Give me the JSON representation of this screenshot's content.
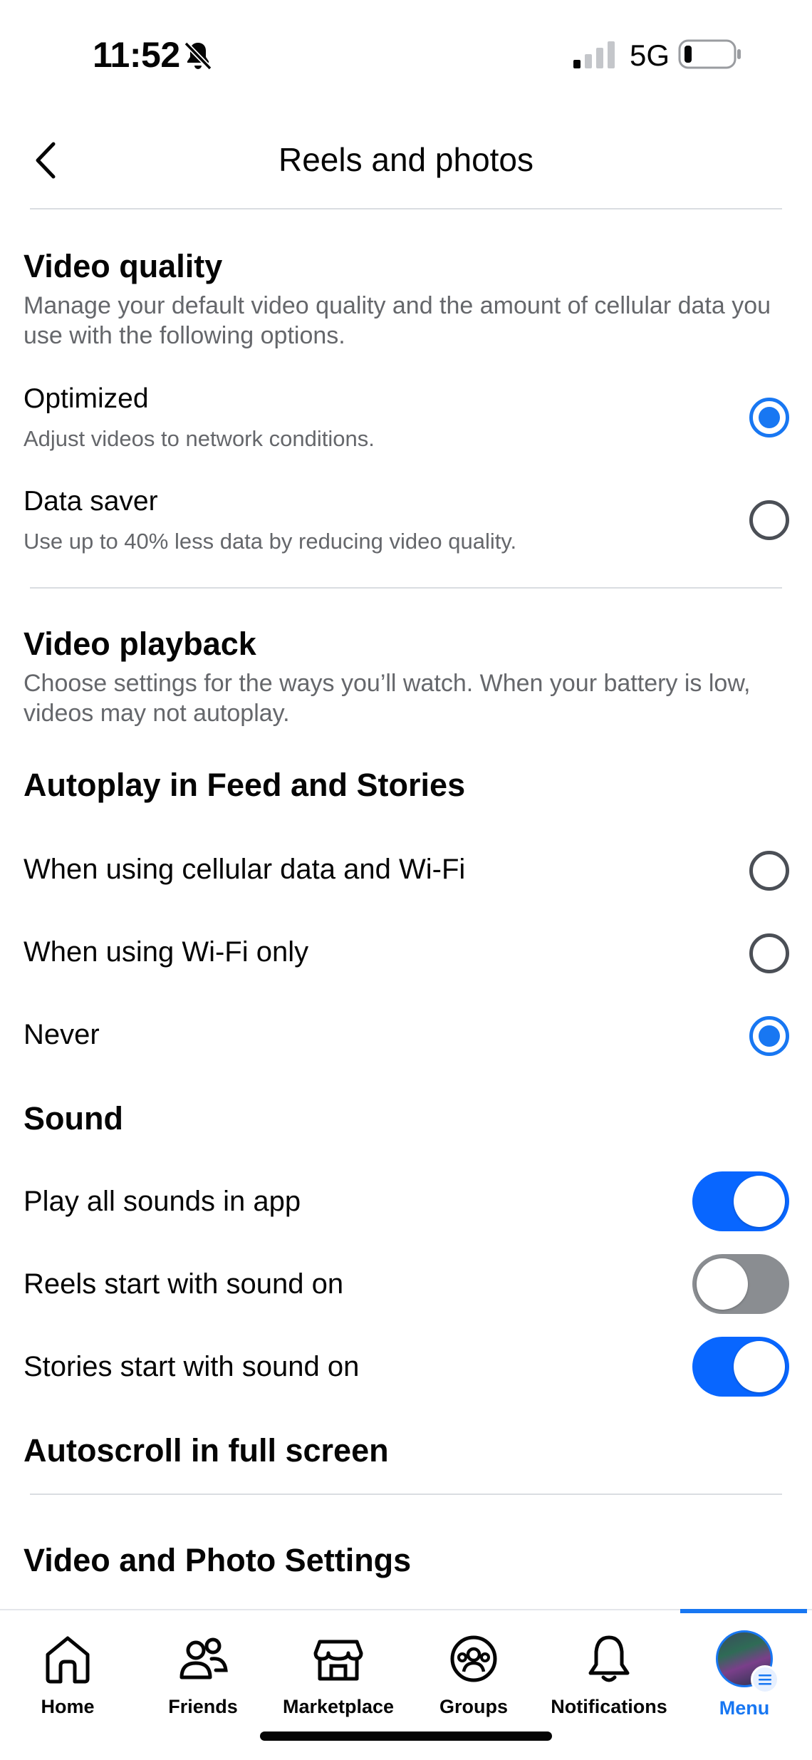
{
  "status_bar": {
    "time": "11:52",
    "network": "5G"
  },
  "header": {
    "title": "Reels and photos"
  },
  "video_quality": {
    "title": "Video quality",
    "description": "Manage your default video quality and the amount of cellular data you use with the following options.",
    "options": [
      {
        "title": "Optimized",
        "subtitle": "Adjust videos to network conditions.",
        "selected": true
      },
      {
        "title": "Data saver",
        "subtitle": "Use up to 40% less data by reducing video quality.",
        "selected": false
      }
    ]
  },
  "video_playback": {
    "title": "Video playback",
    "description": "Choose settings for the ways you’ll watch. When your battery is low, videos may not autoplay."
  },
  "autoplay": {
    "title": "Autoplay in Feed and Stories",
    "options": [
      {
        "label": "When using cellular data and Wi-Fi",
        "selected": false
      },
      {
        "label": "When using Wi-Fi only",
        "selected": false
      },
      {
        "label": "Never",
        "selected": true
      }
    ]
  },
  "sound": {
    "title": "Sound",
    "toggles": [
      {
        "label": "Play all sounds in app",
        "on": true
      },
      {
        "label": "Reels start with sound on",
        "on": false
      },
      {
        "label": "Stories start with sound on",
        "on": true
      }
    ]
  },
  "autoscroll": {
    "title": "Autoscroll in full screen"
  },
  "video_photo_settings": {
    "title": "Video and Photo Settings"
  },
  "bottom_nav": {
    "items": [
      {
        "label": "Home",
        "icon": "home-icon"
      },
      {
        "label": "Friends",
        "icon": "friends-icon"
      },
      {
        "label": "Marketplace",
        "icon": "marketplace-icon"
      },
      {
        "label": "Groups",
        "icon": "groups-icon"
      },
      {
        "label": "Notifications",
        "icon": "bell-icon"
      },
      {
        "label": "Menu",
        "icon": "avatar"
      }
    ],
    "active": "Menu"
  },
  "colors": {
    "accent": "#1877f2",
    "toggle_on": "#0866ff",
    "toggle_off": "#8a8d91",
    "secondary_text": "#65676b"
  }
}
